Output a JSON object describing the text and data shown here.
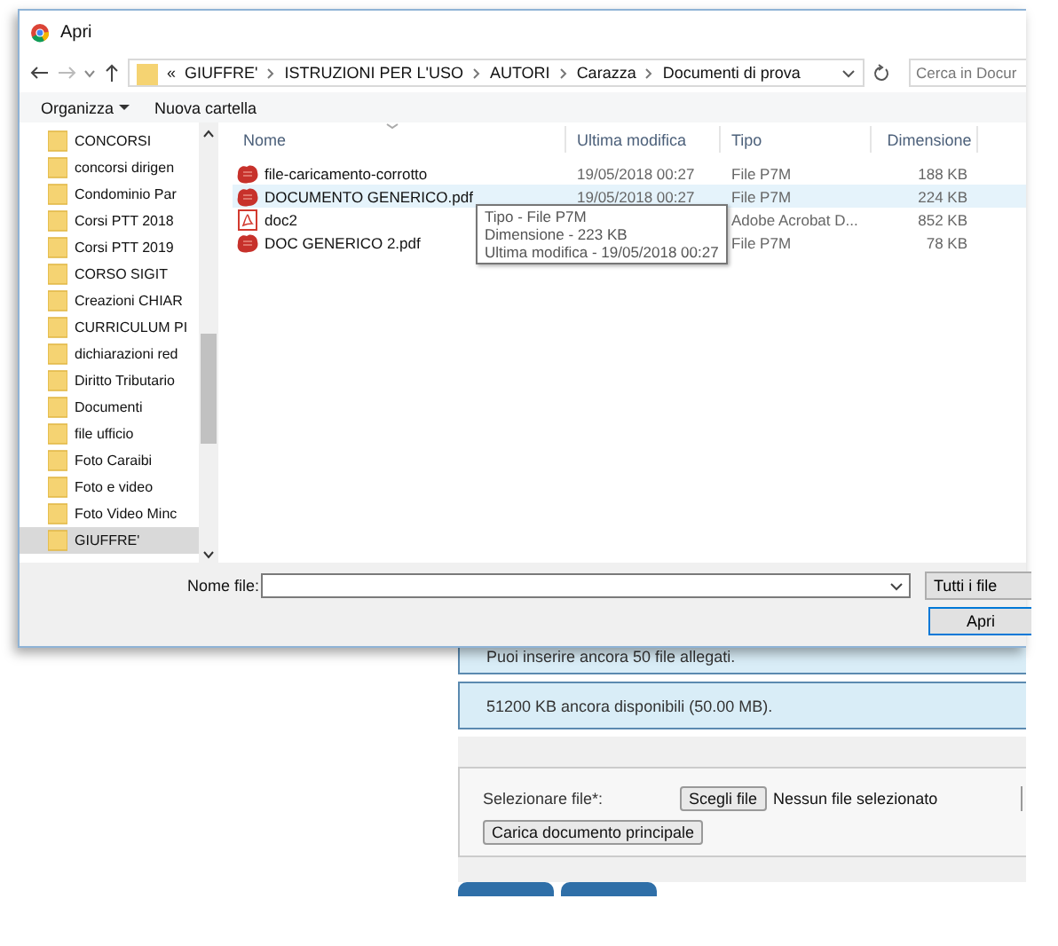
{
  "window": {
    "title": "Apri"
  },
  "address_bar": {
    "breadcrumb": [
      "«",
      "GIUFFRE'",
      "ISTRUZIONI PER L'USO",
      "AUTORI",
      "Carazza",
      "Documenti di prova"
    ],
    "search": {
      "placeholder": "Cerca in Docur"
    }
  },
  "toolbar": [
    {
      "label": "Organizza",
      "kind": "menu"
    },
    {
      "label": "Nuova cartella",
      "kind": "button"
    }
  ],
  "sidebar": {
    "items": [
      {
        "label": "CONCORSI",
        "selected": false
      },
      {
        "label": "concorsi dirigen",
        "selected": false
      },
      {
        "label": "Condominio Par",
        "selected": false
      },
      {
        "label": "Corsi PTT 2018",
        "selected": false
      },
      {
        "label": "Corsi PTT 2019",
        "selected": false
      },
      {
        "label": "CORSO SIGIT",
        "selected": false
      },
      {
        "label": "Creazioni CHIAR",
        "selected": false
      },
      {
        "label": "CURRICULUM PI",
        "selected": false
      },
      {
        "label": "dichiarazioni red",
        "selected": false
      },
      {
        "label": "Diritto Tributario",
        "selected": false
      },
      {
        "label": "Documenti",
        "selected": false
      },
      {
        "label": "file ufficio",
        "selected": false
      },
      {
        "label": "Foto Caraibi",
        "selected": false
      },
      {
        "label": "Foto e video",
        "selected": false
      },
      {
        "label": "Foto Video Minc",
        "selected": false
      },
      {
        "label": "GIUFFRE'",
        "selected": true
      }
    ]
  },
  "file_list": {
    "columns": [
      "Nome",
      "Ultima modifica",
      "Tipo",
      "Dimensione"
    ],
    "rows": [
      {
        "name": "file-caricamento-corrotto",
        "kind": "signed",
        "selected": false,
        "modified": "19/05/2018 00:27",
        "type": "File P7M",
        "size": "188 KB"
      },
      {
        "name": "DOCUMENTO GENERICO.pdf",
        "kind": "signed",
        "selected": true,
        "modified": "19/05/2018 00:27",
        "type": "File P7M",
        "size": "224 KB"
      },
      {
        "name": "doc2",
        "kind": "pdf",
        "selected": false,
        "modified": "",
        "type": "Adobe Acrobat D...",
        "size": "852 KB"
      },
      {
        "name": "DOC GENERICO 2.pdf",
        "kind": "signed",
        "selected": false,
        "modified": "",
        "type": "File P7M",
        "size": "78 KB"
      }
    ]
  },
  "tooltip": {
    "lines": [
      "Tipo - File P7M",
      "Dimensione - 223 KB",
      "Ultima modifica - 19/05/2018 00:27"
    ]
  },
  "footer": {
    "filename_label": "Nome file:",
    "file_type": "Tutti i file",
    "open_button": "Apri"
  },
  "web_page": {
    "notices": [
      "Puoi inserire ancora 50 file allegati.",
      "51200 KB ancora disponibili (50.00 MB)."
    ],
    "file_label": "Selezionare file*:",
    "choose_button": "Scegli file",
    "no_file": "Nessun file selezionato",
    "upload_button": "Carica documento principale"
  }
}
